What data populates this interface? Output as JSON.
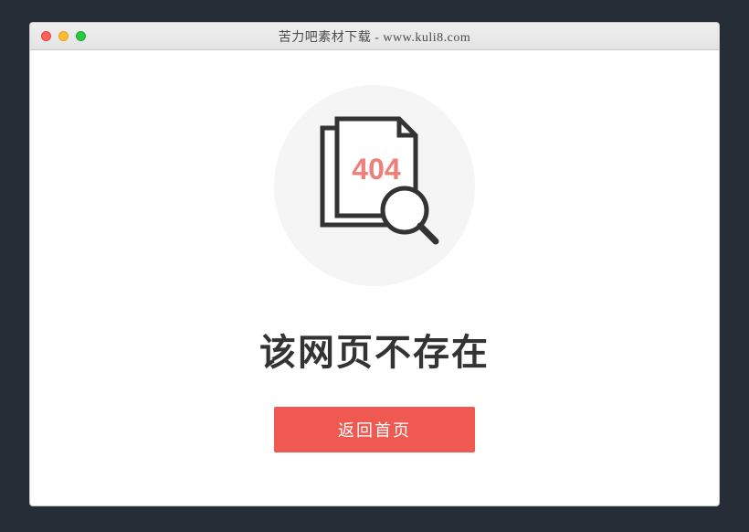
{
  "window": {
    "title": "苦力吧素材下载 - www.kuli8.com"
  },
  "error": {
    "code": "404",
    "heading": "该网页不存在",
    "button_label": "返回首页"
  }
}
